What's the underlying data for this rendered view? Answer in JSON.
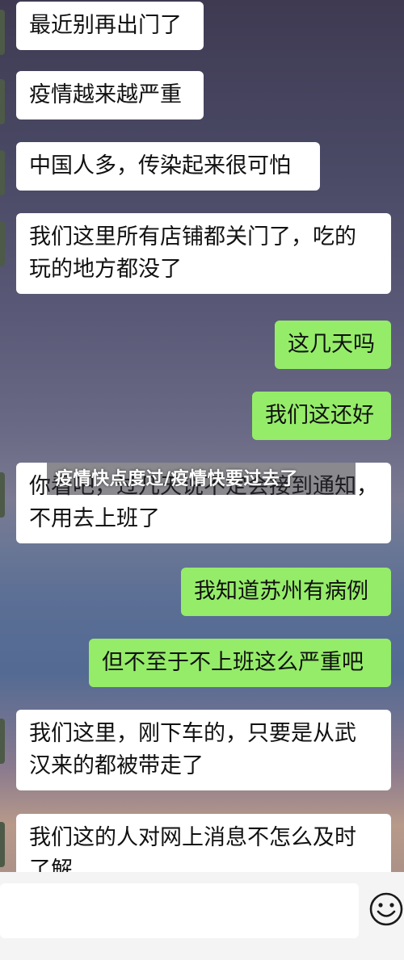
{
  "overlay_title": "疫情快点度过/疫情快要过去了",
  "messages": [
    {
      "side": "in",
      "text": "最近别再出门了"
    },
    {
      "side": "in",
      "text": "疫情越来越严重"
    },
    {
      "side": "in",
      "text": "中国人多，传染起来很可怕"
    },
    {
      "side": "in",
      "text": "我们这里所有店铺都关门了，吃的\n玩的地方都没了"
    },
    {
      "side": "out",
      "text": "这几天吗"
    },
    {
      "side": "out",
      "text": "我们这还好"
    },
    {
      "side": "in",
      "text": "你看吧，过几天说不定会接到通知，\n不用去上班了"
    },
    {
      "side": "out",
      "text": "我知道苏州有病例"
    },
    {
      "side": "out",
      "text": "但不至于不上班这么严重吧"
    },
    {
      "side": "in",
      "text": "我们这里，刚下车的，只要是从武\n汉来的都被带走了"
    },
    {
      "side": "in",
      "text": "我们这的人对网上消息不怎么及时\n了解"
    }
  ],
  "input": {
    "placeholder": "",
    "value": ""
  },
  "icons": {
    "emoji": "emoji-smile-icon"
  },
  "colors": {
    "incoming_bubble": "#ffffff",
    "outgoing_bubble": "#95ec69"
  }
}
